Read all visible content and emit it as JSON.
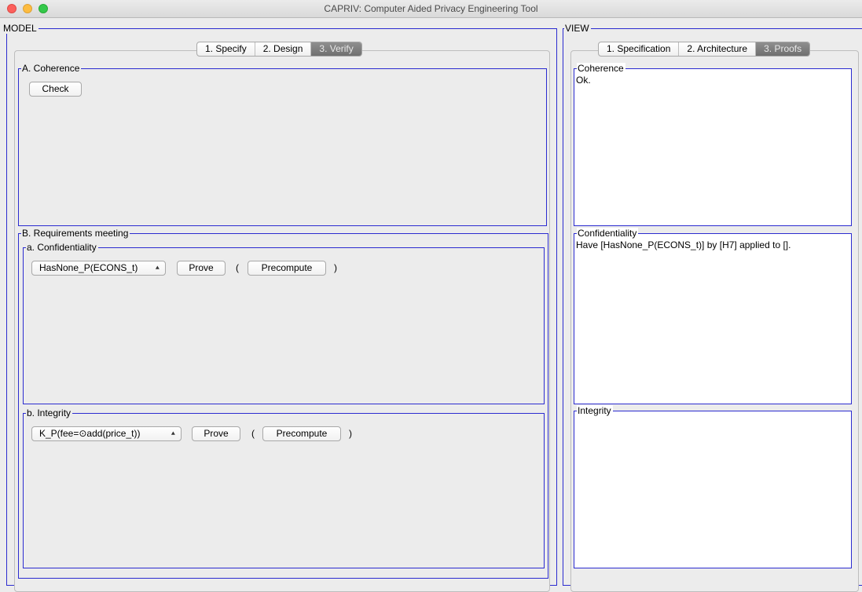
{
  "window": {
    "title": "CAPRIV: Computer Aided Privacy Engineering Tool"
  },
  "model": {
    "label": "MODEL",
    "tabs": [
      {
        "label": "1. Specify",
        "active": false
      },
      {
        "label": "2. Design",
        "active": false
      },
      {
        "label": "3. Verify",
        "active": true
      }
    ],
    "coherence": {
      "label": "A. Coherence",
      "check_button": "Check"
    },
    "requirements": {
      "label": "B. Requirements meeting",
      "confidentiality": {
        "label": "a. Confidentiality",
        "selected": "HasNone_P(ECONS_t)",
        "prove_button": "Prove",
        "open_paren": "(",
        "precompute_button": "Precompute",
        "close_paren": ")"
      },
      "integrity": {
        "label": "b. Integrity",
        "selected": "K_P(fee=⊙add(price_t))",
        "prove_button": "Prove",
        "open_paren": "(",
        "precompute_button": "Precompute",
        "close_paren": ")"
      }
    }
  },
  "view": {
    "label": "VIEW",
    "tabs": [
      {
        "label": "1. Specification",
        "active": false
      },
      {
        "label": "2. Architecture",
        "active": false
      },
      {
        "label": "3. Proofs",
        "active": true
      }
    ],
    "coherence": {
      "label": "Coherence",
      "text": "Ok."
    },
    "confidentiality": {
      "label": "Confidentiality",
      "text": "Have [HasNone_P(ECONS_t)] by [H7] applied to  []."
    },
    "integrity": {
      "label": "Integrity",
      "text": ""
    }
  },
  "icons": {
    "select_arrows": "⇕"
  }
}
